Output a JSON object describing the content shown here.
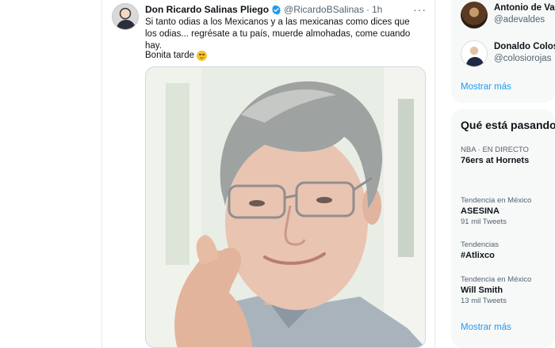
{
  "tweet": {
    "author_name": "Don Ricardo Salinas Pliego",
    "handle": "@RicardoBSalinas",
    "separator": "·",
    "time": "1h",
    "more_label": "···",
    "text": "Si tanto odias a los Mexicanos y a las mexicanas como dices que los odias... regrésate a tu país, muerde almohadas, come cuando hay.",
    "text2": "Bonita tarde",
    "verified_color": "#1d9bf0",
    "icons": [
      "avatar",
      "verified-badge-icon",
      "more-icon",
      "relieved-face-emoji-icon"
    ]
  },
  "sidebar": {
    "who_to_follow": [
      {
        "name": "Antonio de Val",
        "handle": "@adevaldes"
      },
      {
        "name": "Donaldo Colosi",
        "handle": "@colosiorojas"
      }
    ],
    "show_more_follow": "Mostrar más",
    "trends_title": "Qué está pasando",
    "trends": [
      {
        "context": "NBA · EN DIRECTO",
        "name": "76ers at Hornets",
        "count": ""
      },
      {
        "context": "Tendencia en México",
        "name": "ASESINA",
        "count": "91 mil Tweets"
      },
      {
        "context": "Tendencias",
        "name": "#Atlixco",
        "count": ""
      },
      {
        "context": "Tendencia en México",
        "name": "Will Smith",
        "count": "13 mil Tweets"
      }
    ],
    "show_more_trends": "Mostrar más"
  },
  "colors": {
    "link": "#1d9bf0",
    "secondary_text": "#536471",
    "panel_bg": "#f7f9f9"
  }
}
